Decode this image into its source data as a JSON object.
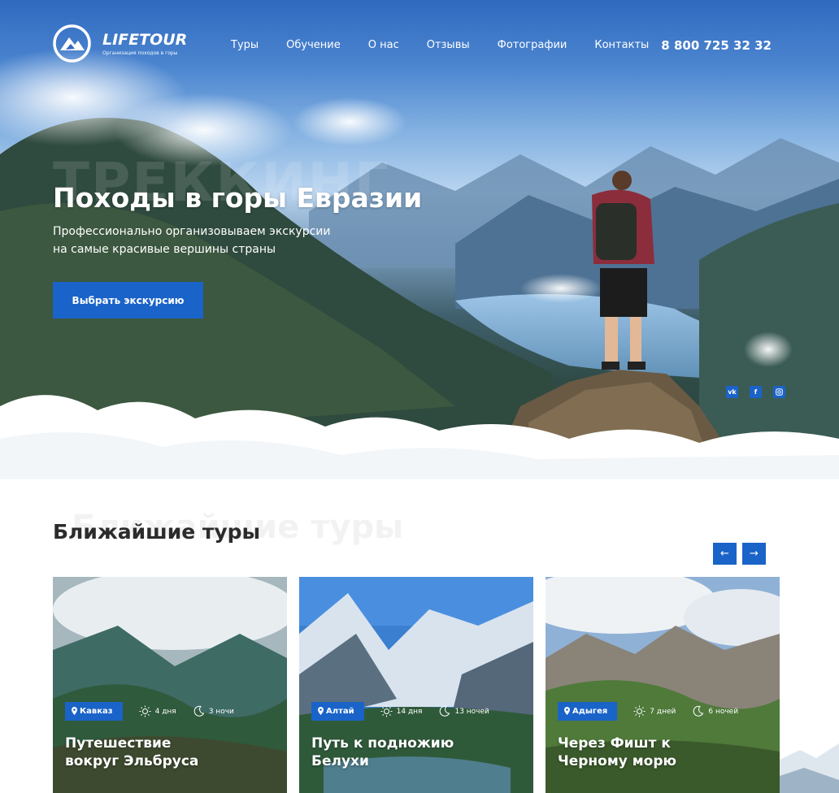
{
  "brand": {
    "name": "LIFETOUR",
    "tagline": "Организация походов в горы"
  },
  "nav": [
    "Туры",
    "Обучение",
    "О нас",
    "Отзывы",
    "Фотографии",
    "Контакты"
  ],
  "phone": "8 800 725 32 32",
  "hero": {
    "ghost_text": "ТРЕККИНГ",
    "title": "Походы в горы Евразии",
    "subtitle_line1": "Профессионально организовываем экскурсии",
    "subtitle_line2": "на самые красивые вершины страны",
    "cta": "Выбрать экскурсию"
  },
  "socials": [
    "vk",
    "f",
    "ig"
  ],
  "tours_section": {
    "ghost_text": "Ближайшие туры",
    "title": "Ближайшие туры",
    "prev_arrow": "←",
    "next_arrow": "→",
    "cards": [
      {
        "region": "Кавказ",
        "days": "4 дня",
        "nights": "3 ночи",
        "title_line1": "Путешествие",
        "title_line2": "вокруг Эльбруса"
      },
      {
        "region": "Алтай",
        "days": "14 дня",
        "nights": "13 ночей",
        "title_line1": "Путь к подножию",
        "title_line2": "Белухи"
      },
      {
        "region": "Адыгея",
        "days": "7 дней",
        "nights": "6 ночей",
        "title_line1": "Через Фишт к",
        "title_line2": "Черному морю"
      }
    ]
  },
  "colors": {
    "accent": "#1a63c8",
    "heading": "#2b2b2b"
  }
}
